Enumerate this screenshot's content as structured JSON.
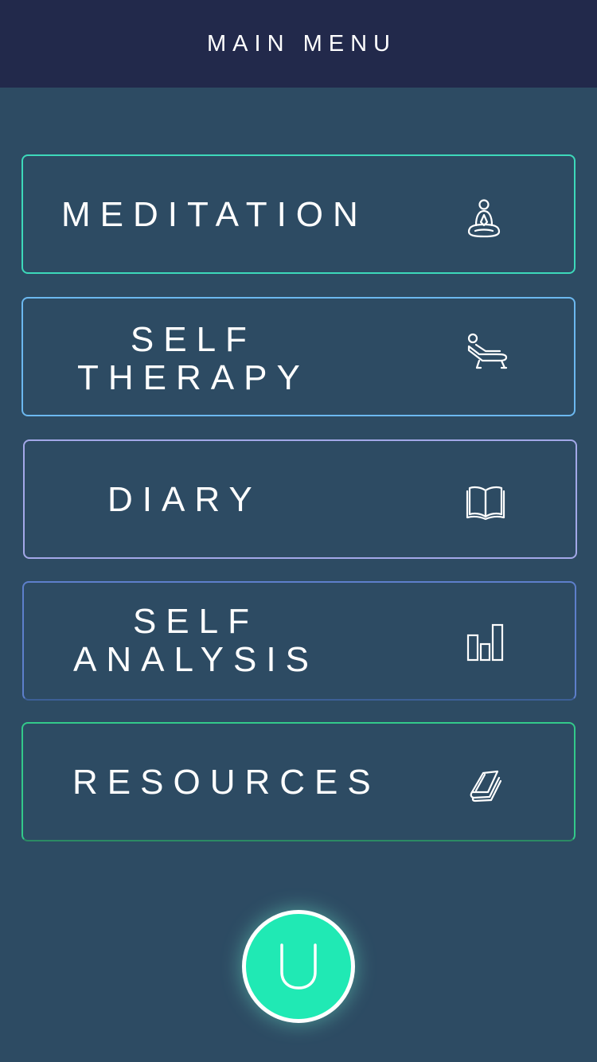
{
  "header": {
    "title": "MAIN MENU"
  },
  "menu": {
    "meditation": {
      "line1": "MEDITATION",
      "icon": "meditation-icon",
      "border_color": "#3dd9ba"
    },
    "therapy": {
      "line1": "SELF",
      "line2": "THERAPY",
      "icon": "therapy-couch-icon",
      "border_color": "#6cb8ef"
    },
    "diary": {
      "line1": "DIARY",
      "icon": "book-icon",
      "border_color": "#a3a8e8"
    },
    "analysis": {
      "line1": "SELF",
      "line2": "ANALYSIS",
      "icon": "bar-chart-icon",
      "border_color": "#5d7fcb"
    },
    "resources": {
      "line1": "RESOURCES",
      "icon": "papers-icon",
      "border_color": "#33c98a"
    }
  },
  "home_button": {
    "icon": "u-logo-icon",
    "color": "#20e9b4"
  },
  "colors": {
    "header_bg": "#22294b",
    "page_bg": "#2d4b63"
  }
}
